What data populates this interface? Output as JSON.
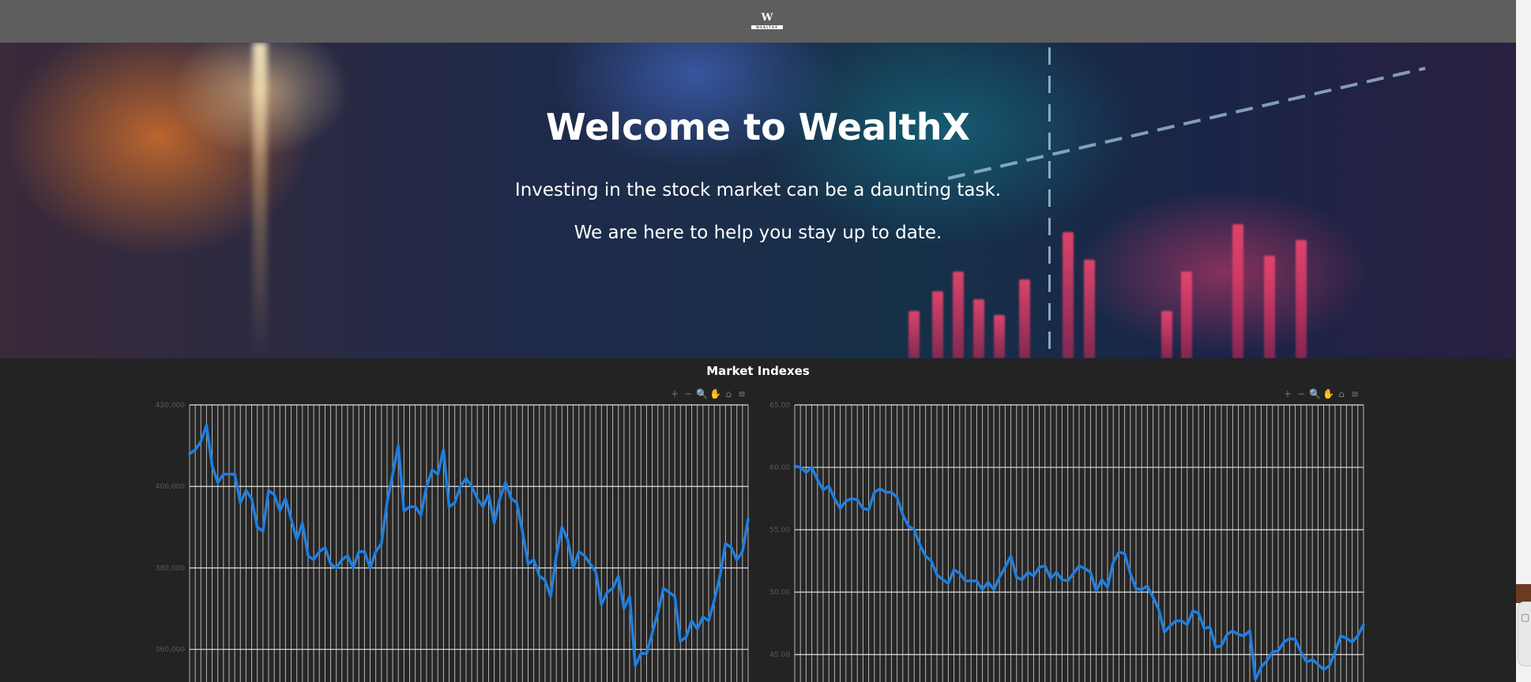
{
  "navbar": {
    "logo_mark": "W",
    "logo_word": "WEALTHX"
  },
  "hero": {
    "title": "Welcome to WealthX",
    "subtitle_1": "Investing in the stock market can be a daunting task.",
    "subtitle_2": "We are here to help you stay up to date."
  },
  "section": {
    "title": "Market Indexes"
  },
  "toolbar": {
    "zoom_in_icon": "+",
    "zoom_out_icon": "−",
    "selection_zoom_icon": "🔍",
    "pan_icon": "✋",
    "reset_icon": "⌂",
    "menu_icon": "≡"
  },
  "colors": {
    "navbar": "#5e5e5e",
    "background": "#232323",
    "series": "#1f7fe0",
    "grid": "#cfcfcf"
  },
  "chart_data": [
    {
      "type": "line",
      "title": "",
      "xlabel": "",
      "ylabel": "",
      "y_tick_labels": [
        "420,000",
        "400,000",
        "380,000",
        "360,000"
      ],
      "y_ticks": [
        420,
        400,
        380,
        360
      ],
      "ylim": [
        352,
        420
      ],
      "grid": true,
      "series": [
        {
          "name": "",
          "values": [
            408,
            409,
            411,
            415,
            405,
            401,
            403,
            403,
            403,
            396,
            399,
            397,
            390,
            389,
            399,
            398,
            394,
            397,
            392,
            387,
            391,
            383,
            382,
            384,
            385,
            381,
            380,
            382,
            383,
            380,
            384,
            384,
            380,
            384,
            386,
            396,
            403,
            410,
            394,
            395,
            395,
            393,
            400,
            404,
            403,
            409,
            395,
            396,
            400,
            402,
            400,
            397,
            395,
            398,
            391,
            397,
            401,
            397,
            396,
            389,
            381,
            382,
            378,
            377,
            373,
            383,
            390,
            387,
            380,
            384,
            383,
            381,
            379,
            371,
            374,
            375,
            378,
            370,
            373,
            356,
            359,
            359,
            364,
            369,
            375,
            374,
            373,
            362,
            363,
            367,
            365,
            368,
            367,
            372,
            378,
            386,
            385,
            382,
            384,
            392
          ]
        }
      ]
    },
    {
      "type": "line",
      "title": "",
      "xlabel": "",
      "ylabel": "",
      "y_tick_labels": [
        "65.00",
        "60.00",
        "55.00",
        "50.00",
        "45.00"
      ],
      "y_ticks": [
        65,
        60,
        55,
        50,
        45
      ],
      "ylim": [
        42.8,
        65
      ],
      "grid": true,
      "series": [
        {
          "name": "",
          "values": [
            60.1,
            60.0,
            59.6,
            60.0,
            59.0,
            58.2,
            58.5,
            57.5,
            56.7,
            57.3,
            57.5,
            57.4,
            56.7,
            56.6,
            58.0,
            58.3,
            58.0,
            58.0,
            57.6,
            56.2,
            55.3,
            55.0,
            53.8,
            52.9,
            52.5,
            51.4,
            51.0,
            50.7,
            51.8,
            51.5,
            50.9,
            50.9,
            50.9,
            50.2,
            50.8,
            50.2,
            51.2,
            52.0,
            52.9,
            51.2,
            51.0,
            51.6,
            51.3,
            52.0,
            52.1,
            51.1,
            51.6,
            51.0,
            50.9,
            51.5,
            52.1,
            51.9,
            51.6,
            50.1,
            51.0,
            50.4,
            52.4,
            53.2,
            53.1,
            51.5,
            50.3,
            50.2,
            50.5,
            49.6,
            48.6,
            46.8,
            47.3,
            47.7,
            47.7,
            47.4,
            48.5,
            48.3,
            47.1,
            47.2,
            45.6,
            45.7,
            46.6,
            46.9,
            46.6,
            46.5,
            46.9,
            43.0,
            44.0,
            44.5,
            45.2,
            45.3,
            46.0,
            46.3,
            46.2,
            45.2,
            44.4,
            44.6,
            44.2,
            43.8,
            44.1,
            45.2,
            46.5,
            46.3,
            46.0,
            46.5,
            47.4
          ]
        }
      ]
    }
  ]
}
